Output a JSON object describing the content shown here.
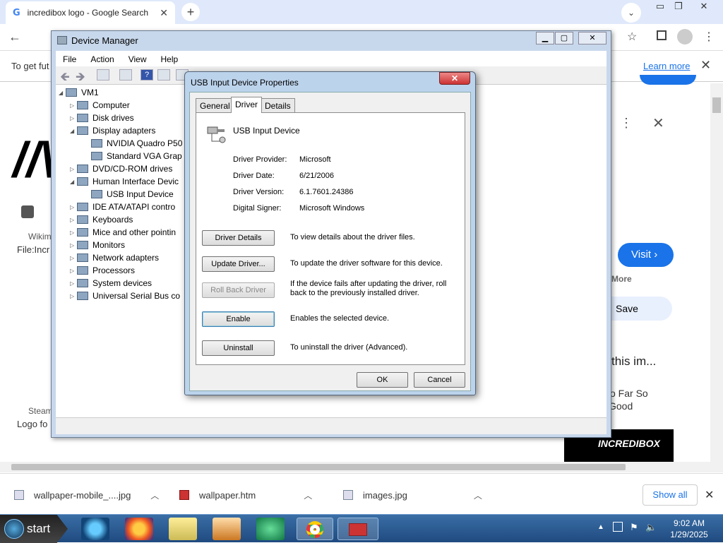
{
  "browser": {
    "tab_title": "incredibox logo - Google Search",
    "tab_icon": "G",
    "infobar_text": "To get fut",
    "learn_more": "Learn more"
  },
  "page_fragments": {
    "wiki_label": "Wikim",
    "file_label": "File:Incr",
    "steam_label": "Steam",
    "logo_label": "Logo fo",
    "visit": "Visit ›",
    "more": "More",
    "save": "Save",
    "this_im": "this im...",
    "so_far": "o Far So",
    "good": "Good",
    "incredibox": "INCREDIBOX"
  },
  "downloads": [
    {
      "name": "wallpaper-mobile_....jpg"
    },
    {
      "name": "wallpaper.htm"
    },
    {
      "name": "images.jpg"
    }
  ],
  "show_all": "Show all",
  "taskbar": {
    "start": "start",
    "time": "9:02 AM",
    "date": "1/29/2025"
  },
  "device_manager": {
    "title": "Device Manager",
    "menu": [
      "File",
      "Action",
      "View",
      "Help"
    ],
    "tree": [
      {
        "label": "VM1",
        "level": 0,
        "toggle": "◢"
      },
      {
        "label": "Computer",
        "level": 1,
        "toggle": "▷"
      },
      {
        "label": "Disk drives",
        "level": 1,
        "toggle": "▷"
      },
      {
        "label": "Display adapters",
        "level": 1,
        "toggle": "◢"
      },
      {
        "label": "NVIDIA Quadro P50",
        "level": 2,
        "toggle": ""
      },
      {
        "label": "Standard VGA Grap",
        "level": 2,
        "toggle": ""
      },
      {
        "label": "DVD/CD-ROM drives",
        "level": 1,
        "toggle": "▷"
      },
      {
        "label": "Human Interface Devic",
        "level": 1,
        "toggle": "◢"
      },
      {
        "label": "USB Input Device",
        "level": 2,
        "toggle": ""
      },
      {
        "label": "IDE ATA/ATAPI contro",
        "level": 1,
        "toggle": "▷"
      },
      {
        "label": "Keyboards",
        "level": 1,
        "toggle": "▷"
      },
      {
        "label": "Mice and other pointin",
        "level": 1,
        "toggle": "▷"
      },
      {
        "label": "Monitors",
        "level": 1,
        "toggle": "▷"
      },
      {
        "label": "Network adapters",
        "level": 1,
        "toggle": "▷"
      },
      {
        "label": "Processors",
        "level": 1,
        "toggle": "▷"
      },
      {
        "label": "System devices",
        "level": 1,
        "toggle": "▷"
      },
      {
        "label": "Universal Serial Bus co",
        "level": 1,
        "toggle": "▷"
      }
    ]
  },
  "properties": {
    "title": "USB Input Device Properties",
    "close": "✕",
    "tabs": [
      "General",
      "Driver",
      "Details"
    ],
    "device_name": "USB Input Device",
    "fields": [
      {
        "label": "Driver Provider:",
        "value": "Microsoft"
      },
      {
        "label": "Driver Date:",
        "value": "6/21/2006"
      },
      {
        "label": "Driver Version:",
        "value": "6.1.7601.24386"
      },
      {
        "label": "Digital Signer:",
        "value": "Microsoft Windows"
      }
    ],
    "actions": [
      {
        "button": "Driver Details",
        "desc": "To view details about the driver files."
      },
      {
        "button": "Update Driver...",
        "desc": "To update the driver software for this device."
      },
      {
        "button": "Roll Back Driver",
        "desc": "If the device fails after updating the driver, roll back to the previously installed driver."
      },
      {
        "button": "Enable",
        "desc": "Enables the selected device."
      },
      {
        "button": "Uninstall",
        "desc": "To uninstall the driver (Advanced)."
      }
    ],
    "ok": "OK",
    "cancel": "Cancel"
  }
}
